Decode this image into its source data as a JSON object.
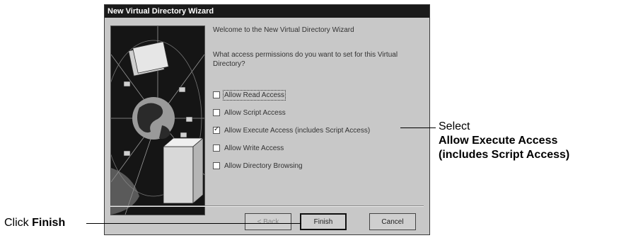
{
  "dialog": {
    "title": "New Virtual Directory Wizard",
    "welcome": "Welcome to the New Virtual Directory Wizard",
    "question": "What access permissions do you want to set for this Virtual Directory?",
    "options": [
      {
        "label": "Allow Read Access",
        "checked": false
      },
      {
        "label": "Allow Script Access",
        "checked": false
      },
      {
        "label": "Allow Execute Access (includes Script Access)",
        "checked": true
      },
      {
        "label": "Allow Write Access",
        "checked": false
      },
      {
        "label": "Allow Directory Browsing",
        "checked": false
      }
    ],
    "buttons": {
      "back": "< Back",
      "finish": "Finish",
      "cancel": "Cancel"
    }
  },
  "annotations": {
    "select_prefix": "Select",
    "select_line1": "Allow Execute Access",
    "select_line2": "(includes Script Access)",
    "finish_prefix": "Click ",
    "finish_label": "Finish"
  },
  "colors": {
    "dialog_bg": "#c8c8c8",
    "titlebar_bg": "#1a1a1a",
    "art_bg": "#111111"
  }
}
